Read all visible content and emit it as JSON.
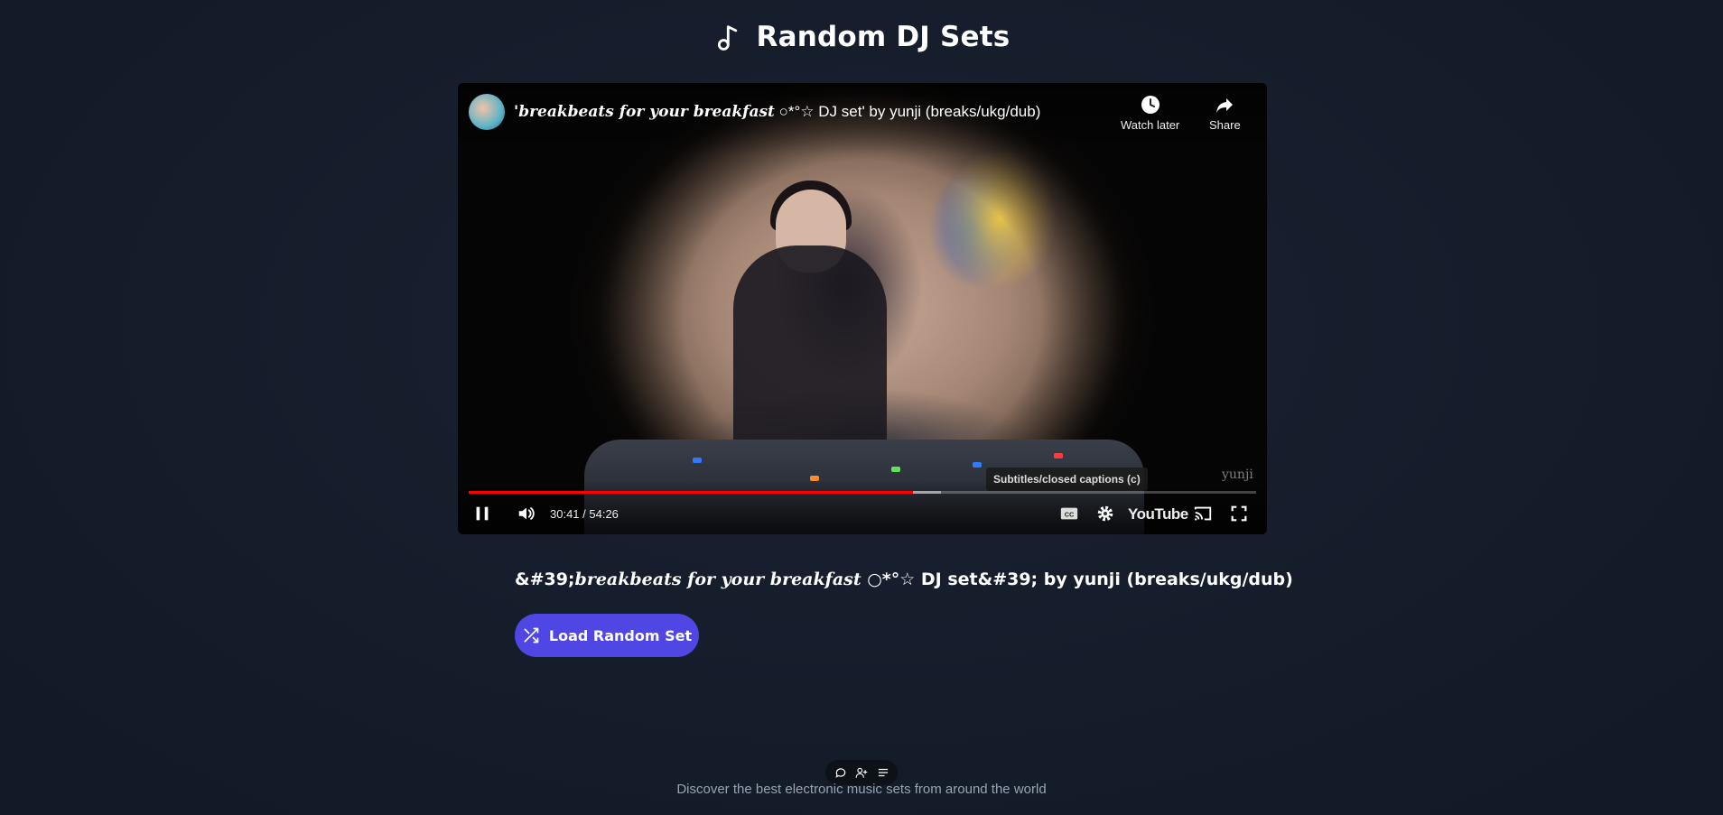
{
  "header": {
    "title": "Random DJ Sets",
    "icon": "music-note-icon"
  },
  "player": {
    "video_title_bold": "'breakbeats for your breakfast",
    "video_title_rest": " ○*°☆ DJ set' by yunji (breaks/ukg/dub)",
    "watch_later_label": "Watch later",
    "share_label": "Share",
    "tooltip": "Subtitles/closed captions (c)",
    "watermark": "yunji",
    "time": "30:41 / 54:26",
    "progress_fraction": 0.564,
    "buffer_fraction": 0.6,
    "brand": "YouTube",
    "progress_color": "#ff0000"
  },
  "set": {
    "title_prefix": "&#39;",
    "title_bold": "breakbeats for your breakfast",
    "title_rest": " ○*°☆ DJ set&#39; by yunji (breaks/ukg/dub)"
  },
  "load_button": {
    "label": "Load Random Set",
    "icon": "shuffle-icon",
    "color": "#5046e4"
  },
  "mini_toolbar": {
    "icons": [
      "comment-icon",
      "user-plus-icon",
      "list-icon"
    ]
  },
  "footer": {
    "text": "Discover the best electronic music sets from around the world"
  }
}
